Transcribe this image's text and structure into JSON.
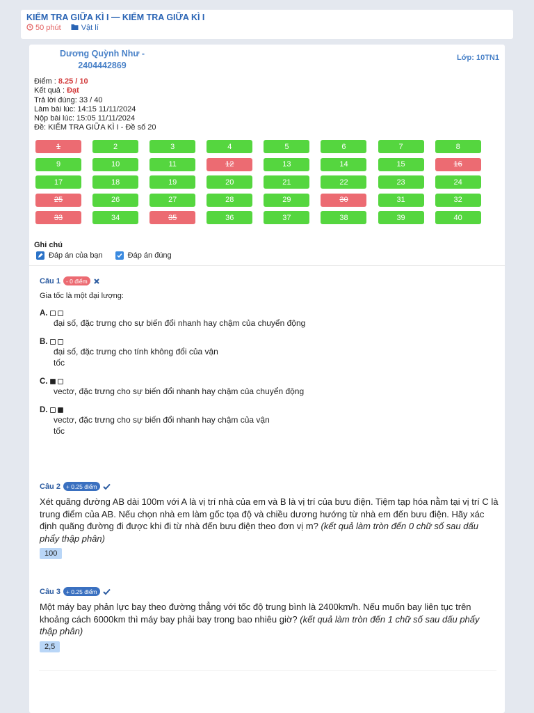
{
  "exam": {
    "title": "KIỂM TRA GIỮA KÌ I — KIỂM TRA GIỮA KÌ I",
    "duration": "50 phút",
    "subject": "Vật lí"
  },
  "student": {
    "name": "Dương Quỳnh Như - 2404442869",
    "class_label": "Lớp: 10TN1"
  },
  "result": {
    "score_label": "Điểm :",
    "score_value": "8.25 / 10",
    "outcome_label": "Kết quả :",
    "outcome_value": "Đạt",
    "correct": "Trả lời đúng: 33 / 40",
    "started": "Làm bài lúc: 14:15 11/11/2024",
    "submitted": "Nộp bài lúc: 15:05 11/11/2024",
    "paper": "Đề: KIỂM TRA GIỮA KÌ I - Đề số 20"
  },
  "question_grid": [
    {
      "n": "1",
      "status": "wrong"
    },
    {
      "n": "2",
      "status": "ok"
    },
    {
      "n": "3",
      "status": "ok"
    },
    {
      "n": "4",
      "status": "ok"
    },
    {
      "n": "5",
      "status": "ok"
    },
    {
      "n": "6",
      "status": "ok"
    },
    {
      "n": "7",
      "status": "ok"
    },
    {
      "n": "8",
      "status": "ok"
    },
    {
      "n": "9",
      "status": "ok"
    },
    {
      "n": "10",
      "status": "ok"
    },
    {
      "n": "11",
      "status": "ok"
    },
    {
      "n": "12",
      "status": "wrong"
    },
    {
      "n": "13",
      "status": "ok"
    },
    {
      "n": "14",
      "status": "ok"
    },
    {
      "n": "15",
      "status": "ok"
    },
    {
      "n": "16",
      "status": "wrong"
    },
    {
      "n": "17",
      "status": "ok"
    },
    {
      "n": "18",
      "status": "ok"
    },
    {
      "n": "19",
      "status": "ok"
    },
    {
      "n": "20",
      "status": "ok"
    },
    {
      "n": "21",
      "status": "ok"
    },
    {
      "n": "22",
      "status": "ok"
    },
    {
      "n": "23",
      "status": "ok"
    },
    {
      "n": "24",
      "status": "ok"
    },
    {
      "n": "25",
      "status": "wrong"
    },
    {
      "n": "26",
      "status": "ok"
    },
    {
      "n": "27",
      "status": "ok"
    },
    {
      "n": "28",
      "status": "ok"
    },
    {
      "n": "29",
      "status": "ok"
    },
    {
      "n": "30",
      "status": "wrong"
    },
    {
      "n": "31",
      "status": "ok"
    },
    {
      "n": "32",
      "status": "ok"
    },
    {
      "n": "33",
      "status": "wrong"
    },
    {
      "n": "34",
      "status": "ok"
    },
    {
      "n": "35",
      "status": "wrong"
    },
    {
      "n": "36",
      "status": "ok"
    },
    {
      "n": "37",
      "status": "ok"
    },
    {
      "n": "38",
      "status": "ok"
    },
    {
      "n": "39",
      "status": "ok"
    },
    {
      "n": "40",
      "status": "ok"
    }
  ],
  "legend": {
    "title": "Ghi chú",
    "yours": "Đáp án của bạn",
    "correct": "Đáp án đúng"
  },
  "questions": {
    "q1": {
      "label": "Câu 1",
      "badge": "- 0 điểm",
      "stem": "Gia tốc là một đại lượng:",
      "options": [
        {
          "letter": "A.",
          "text": "đại số, đặc trưng cho sự biến đổi nhanh hay chậm của chuyển động"
        },
        {
          "letter": "B.",
          "text": "đại số, đặc trưng cho tính không đổi của vận tốc"
        },
        {
          "letter": "C.",
          "text": "vectơ, đặc trưng cho sự biến đổi nhanh hay chậm của chuyển động"
        },
        {
          "letter": "D.",
          "text": "vectơ, đặc trưng cho sự biến đổi nhanh hay chậm của vận tốc"
        }
      ]
    },
    "q2": {
      "label": "Câu 2",
      "badge": "+ 0.25 điểm",
      "stem": "Xét quãng đường AB dài 100m với A là vị trí nhà của em và B là vị trí của bưu điện. Tiệm tạp hóa nằm tại vị trí C là trung điểm của AB. Nếu chọn nhà em làm gốc tọa độ và chiều dương hướng từ nhà em đến bưu điện. Hãy xác định quãng đường đi được khi đi từ nhà đến bưu điện theo đơn vị m?",
      "hint": "(kết quả làm tròn đến 0 chữ số sau dấu phẩy thập phân)",
      "answer": "100"
    },
    "q3": {
      "label": "Câu 3",
      "badge": "+ 0.25 điểm",
      "stem": "Một máy bay phản lực bay theo đường thẳng với tốc độ trung bình là 2400km/h. Nếu muốn bay liên tục trên khoảng cách 6000km thì máy bay phải bay trong bao nhiêu giờ?",
      "hint": "(kết quả làm tròn đến 1 chữ số sau dấu phẩy thập phân)",
      "answer": "2,5"
    }
  },
  "colors": {
    "correct": "#55d63f",
    "wrong": "#ec6b72",
    "accent": "#2a64b4"
  }
}
